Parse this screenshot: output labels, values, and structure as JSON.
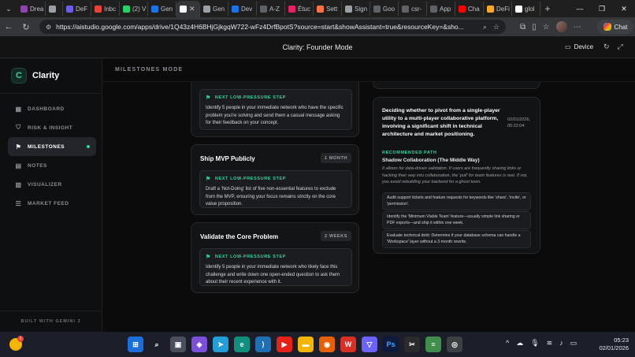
{
  "browser": {
    "tabs": [
      {
        "label": "Drea",
        "color": "#8e44ad"
      },
      {
        "label": "",
        "color": "#9aa0a6"
      },
      {
        "label": "DeF",
        "color": "#6c5ce7"
      },
      {
        "label": "Inbc",
        "color": "#ea4335"
      },
      {
        "label": "(2) V",
        "color": "#25d366"
      },
      {
        "label": "Gen",
        "color": "#1a73e8"
      },
      {
        "label": "",
        "color": "#ffffff",
        "active": true
      },
      {
        "label": "Gen",
        "color": "#9aa0a6"
      },
      {
        "label": "Dev",
        "color": "#1a73e8"
      },
      {
        "label": "A-Z",
        "color": "#5f6368"
      },
      {
        "label": "Étuc",
        "color": "#e91e63"
      },
      {
        "label": "Sett",
        "color": "#ff7043"
      },
      {
        "label": "Sign",
        "color": "#9aa0a6"
      },
      {
        "label": "Goo",
        "color": "#5f6368"
      },
      {
        "label": "csr-",
        "color": "#5f6368"
      },
      {
        "label": "App",
        "color": "#5f6368"
      },
      {
        "label": "Cha",
        "color": "#ff0000"
      },
      {
        "label": "DeFi",
        "color": "#f9a825"
      },
      {
        "label": "glol",
        "color": "#ffffff"
      }
    ],
    "url": "https://aistudio.google.com/apps/drive/1Q43z4H6BHjGjkgqW722-wFz4DrfBpotS?source=start&showAssistant=true&resourceKey=&sho...",
    "chat_label": "Chat"
  },
  "app": {
    "title": "Clarity: Founder Mode",
    "device_label": "Device",
    "brand": "Clarity",
    "mode_title": "MILESTONES MODE",
    "footer": "BUILT WITH GEMINI 3",
    "menu": [
      {
        "label": "DASHBOARD",
        "icon": "grid-icon",
        "active": false
      },
      {
        "label": "RISK & INSIGHT",
        "icon": "shield-icon",
        "active": false
      },
      {
        "label": "MILESTONES",
        "icon": "flag-icon",
        "active": true
      },
      {
        "label": "NOTES",
        "icon": "note-icon",
        "active": false
      },
      {
        "label": "VISUALIZER",
        "icon": "image-icon",
        "active": false
      },
      {
        "label": "MARKET FEED",
        "icon": "feed-icon",
        "active": false
      }
    ]
  },
  "milestones": {
    "step_label": "NEXT LOW-PRESSURE STEP",
    "top_step_text": "Identify 5 people in your immediate network who have the specific problem you're solving and send them a casual message asking for their feedback on your concept.",
    "cards": [
      {
        "title": "Ship MVP Publicly",
        "badge": "1 MONTH",
        "step": "Draft a 'Not-Doing' list of five non-essential features to exclude from the MVP, ensuring your focus remains strictly on the core value proposition."
      },
      {
        "title": "Validate the Core Problem",
        "badge": "2 WEEKS",
        "step": "Identify 5 people in your immediate network who likely face this challenge and write down one open-ended question to ask them about their recent experience with it."
      }
    ]
  },
  "decision": {
    "question": "Deciding whether to pivot from a single-player utility to a multi-player collaborative platform, involving a significant shift in technical architecture and market positioning.",
    "date": "02/01/2026,",
    "time": "05:22:04",
    "rec_label": "RECOMMENDED PATH",
    "rec_title": "Shadow Collaboration (The Middle Way)",
    "rec_desc": "It allows for data-driven validation. If users are frequently sharing links or hacking their way into collaboration, the 'pull' for team features is real. If not, you avoid rebuilding your backend for a ghost town.",
    "actions": [
      "Audit support tickets and feature requests for keywords like 'share', 'invite', or 'permission'.",
      "Identify the 'Minimum Viable Team' feature—usually simple link sharing or PDF exports—and ship it within one week.",
      "Evaluate technical debt: Determine if your database schema can handle a 'Workspace' layer without a 3-month rewrite."
    ]
  },
  "taskbar": {
    "time": "05:23",
    "date": "02/01/2026",
    "weather_badge": "1"
  }
}
